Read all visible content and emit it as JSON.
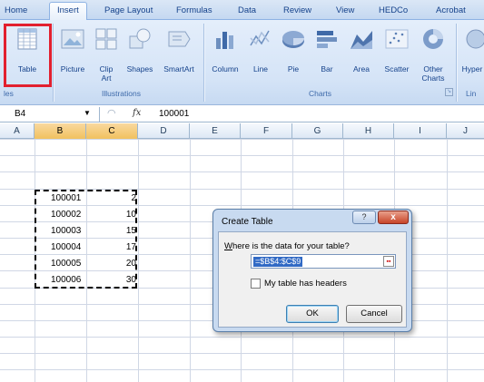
{
  "tabs": [
    "Home",
    "Insert",
    "Page Layout",
    "Formulas",
    "Data",
    "Review",
    "View",
    "HEDCo",
    "Acrobat"
  ],
  "active_tab": "Insert",
  "ribbon": {
    "buttons": {
      "table": "Table",
      "picture": "Picture",
      "clip_art": "Clip\nArt",
      "shapes": "Shapes",
      "smartart": "SmartArt",
      "column": "Column",
      "line": "Line",
      "pie": "Pie",
      "bar": "Bar",
      "area": "Area",
      "scatter": "Scatter",
      "other_charts": "Other\nCharts",
      "hyperlink": "Hyper"
    },
    "groups": {
      "tables": "les",
      "illustrations": "Illustrations",
      "charts": "Charts",
      "links": "Lin"
    }
  },
  "formula_bar": {
    "name_box": "B4",
    "fx": "fx",
    "value": "100001"
  },
  "columns": [
    "A",
    "B",
    "C",
    "D",
    "E",
    "F",
    "G",
    "H",
    "I",
    "J"
  ],
  "selected_columns": [
    "B",
    "C"
  ],
  "cells": [
    {
      "b": "100001",
      "c": "2"
    },
    {
      "b": "100002",
      "c": "10"
    },
    {
      "b": "100003",
      "c": "15"
    },
    {
      "b": "100004",
      "c": "17"
    },
    {
      "b": "100005",
      "c": "20"
    },
    {
      "b": "100006",
      "c": "30"
    }
  ],
  "dialog": {
    "title": "Create Table",
    "help": "?",
    "close": "x",
    "question": "Where is the data for your table?",
    "range": "=$B$4:$C$9",
    "checkbox_label": "My table has headers",
    "checkbox_checked": false,
    "ok": "OK",
    "cancel": "Cancel"
  },
  "colors": {
    "highlight": "#e2202f",
    "selected_header": "#f1c15f",
    "selection": "#316ac5"
  }
}
